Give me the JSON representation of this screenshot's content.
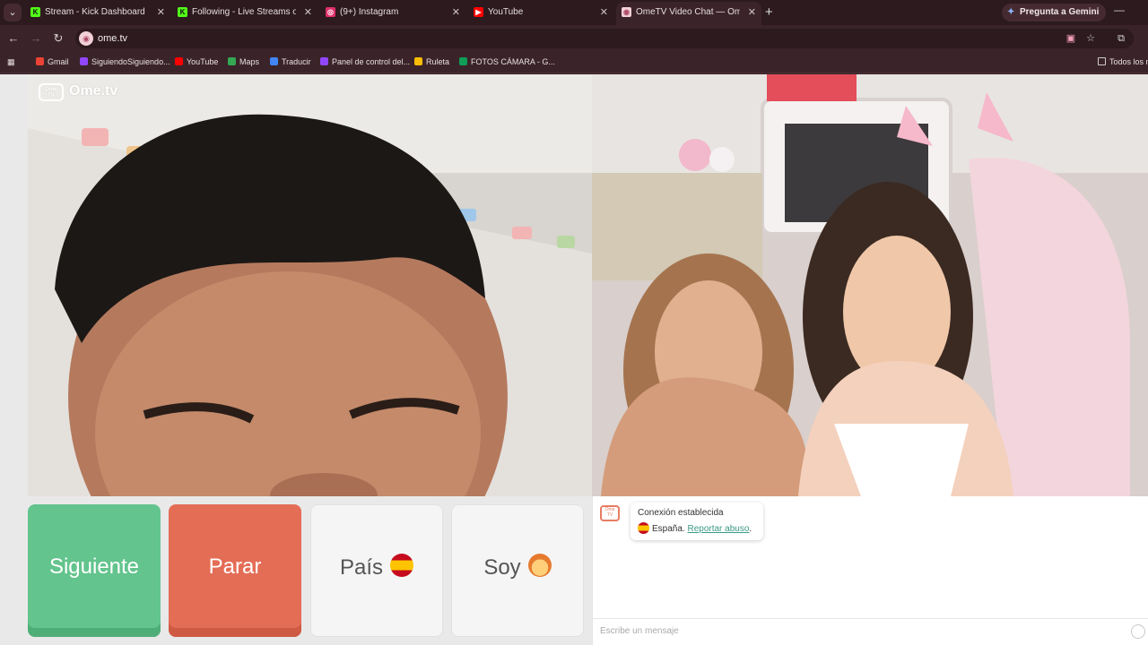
{
  "browser": {
    "tabs": [
      {
        "title": "Stream - Kick Dashboard",
        "icon": "kick-icon",
        "color": "#53fc18",
        "glyph": "K"
      },
      {
        "title": "Following - Live Streams on Kic",
        "icon": "kick-icon",
        "color": "#53fc18",
        "glyph": "K"
      },
      {
        "title": "(9+) Instagram",
        "icon": "instagram-icon",
        "color": "#e1306c",
        "glyph": "◎"
      },
      {
        "title": "YouTube",
        "icon": "youtube-icon",
        "color": "#ff0000",
        "glyph": "▶"
      },
      {
        "title": "OmeTV Video Chat — Ome",
        "icon": "ometv-icon",
        "color": "#f2d0d8",
        "glyph": "◉",
        "active": true
      }
    ],
    "gemini_label": "Pregunta a Gemini",
    "url": "ome.tv",
    "bookmarks": [
      {
        "label": "Gmail",
        "color": "#ea4335"
      },
      {
        "label": "SiguiendoSiguiendo...",
        "color": "#9146ff"
      },
      {
        "label": "YouTube",
        "color": "#ff0000"
      },
      {
        "label": "Maps",
        "color": "#34a853"
      },
      {
        "label": "Traducir",
        "color": "#4285f4"
      },
      {
        "label": "Panel de control del...",
        "color": "#9146ff"
      },
      {
        "label": "Ruleta",
        "color": "#fbbc05"
      },
      {
        "label": "FOTOS CÁMARA - G...",
        "color": "#0f9d58"
      }
    ],
    "all_bookmarks_label": "Todos los m"
  },
  "app": {
    "logo_text": "Ome.tv",
    "logo_badge": "Ome TV",
    "buttons": {
      "next": "Siguiente",
      "stop": "Parar",
      "country": "País",
      "gender": "Soy"
    },
    "chat": {
      "status": "Conexión establecida",
      "country": "España.",
      "report": "Reportar abuso",
      "report_suffix": ".",
      "placeholder": "Escribe un mensaje"
    }
  }
}
